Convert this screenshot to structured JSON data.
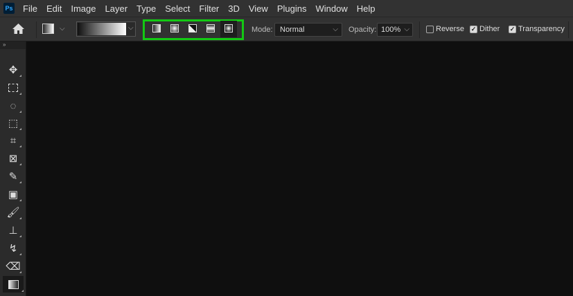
{
  "app": {
    "logo": "Ps"
  },
  "menu": [
    "File",
    "Edit",
    "Image",
    "Layer",
    "Type",
    "Select",
    "Filter",
    "3D",
    "View",
    "Plugins",
    "Window",
    "Help"
  ],
  "options": {
    "home_icon": "home-icon",
    "gradient_types": [
      "linear",
      "radial",
      "angle",
      "reflected",
      "diamond"
    ],
    "selected_gradient_type": "diamond",
    "mode_label": "Mode:",
    "mode_value": "Normal",
    "opacity_label": "Opacity:",
    "opacity_value": "100%",
    "reverse_label": "Reverse",
    "reverse_checked": false,
    "dither_label": "Dither",
    "dither_checked": true,
    "transparency_label": "Transparency",
    "transparency_checked": true,
    "highlight_color": "#13c913"
  },
  "toolbar": {
    "collapse": "»",
    "tools": [
      "move",
      "marquee",
      "lasso",
      "object-select",
      "crop",
      "frame",
      "eyedropper",
      "healing",
      "brush",
      "stamp",
      "history-brush",
      "eraser",
      "gradient"
    ],
    "active": "gradient"
  }
}
